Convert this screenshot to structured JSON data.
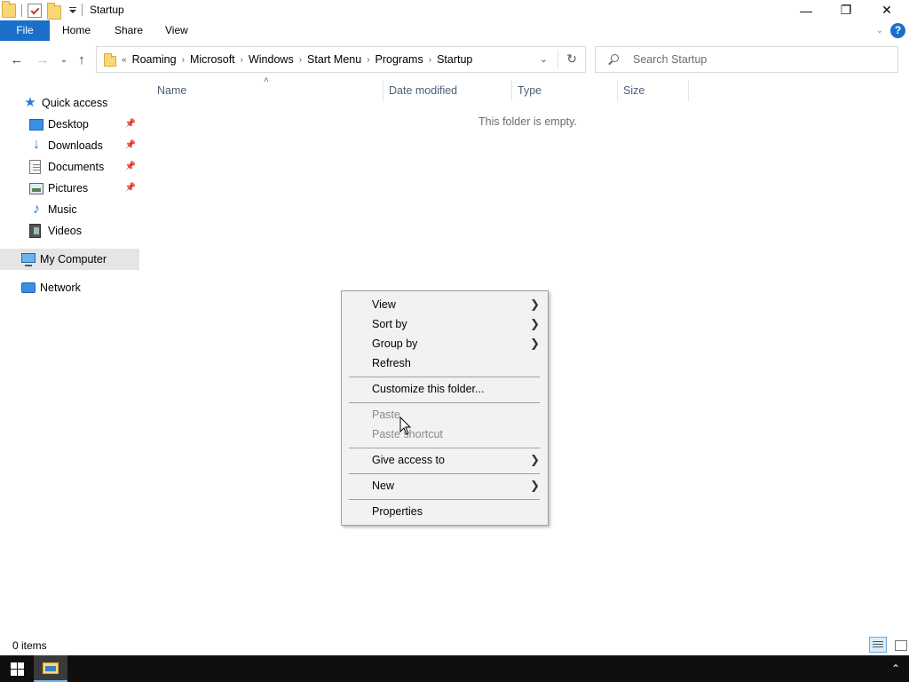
{
  "window": {
    "title": "Startup",
    "controls": {
      "minimize": "—",
      "maximize": "❐",
      "close": "✕"
    }
  },
  "ribbon": {
    "tabs": [
      "File",
      "Home",
      "Share",
      "View"
    ],
    "help": "?"
  },
  "address": {
    "overflow": "«",
    "crumbs": [
      "Roaming",
      "Microsoft",
      "Windows",
      "Start Menu",
      "Programs",
      "Startup"
    ]
  },
  "search": {
    "placeholder": "Search Startup"
  },
  "navpane": {
    "quick_access": "Quick access",
    "items": [
      {
        "label": "Desktop",
        "icon": "desktop-icon",
        "pinned": true
      },
      {
        "label": "Downloads",
        "icon": "downloads-icon",
        "pinned": true
      },
      {
        "label": "Documents",
        "icon": "documents-icon",
        "pinned": true
      },
      {
        "label": "Pictures",
        "icon": "pictures-icon",
        "pinned": true
      },
      {
        "label": "Music",
        "icon": "music-icon",
        "pinned": false
      },
      {
        "label": "Videos",
        "icon": "videos-icon",
        "pinned": false
      }
    ],
    "computer": "My Computer",
    "network": "Network"
  },
  "columns": [
    "Name",
    "Date modified",
    "Type",
    "Size"
  ],
  "content": {
    "empty_message": "This folder is empty."
  },
  "context_menu": {
    "view": "View",
    "sort_by": "Sort by",
    "group_by": "Group by",
    "refresh": "Refresh",
    "customize": "Customize this folder...",
    "paste": "Paste",
    "paste_shortcut": "Paste shortcut",
    "give_access": "Give access to",
    "new": "New",
    "properties": "Properties"
  },
  "status": {
    "item_count": "0 items"
  },
  "colors": {
    "accent": "#1a6fc9",
    "selection": "#e5e5e5",
    "taskbar": "#0f0f0f"
  }
}
